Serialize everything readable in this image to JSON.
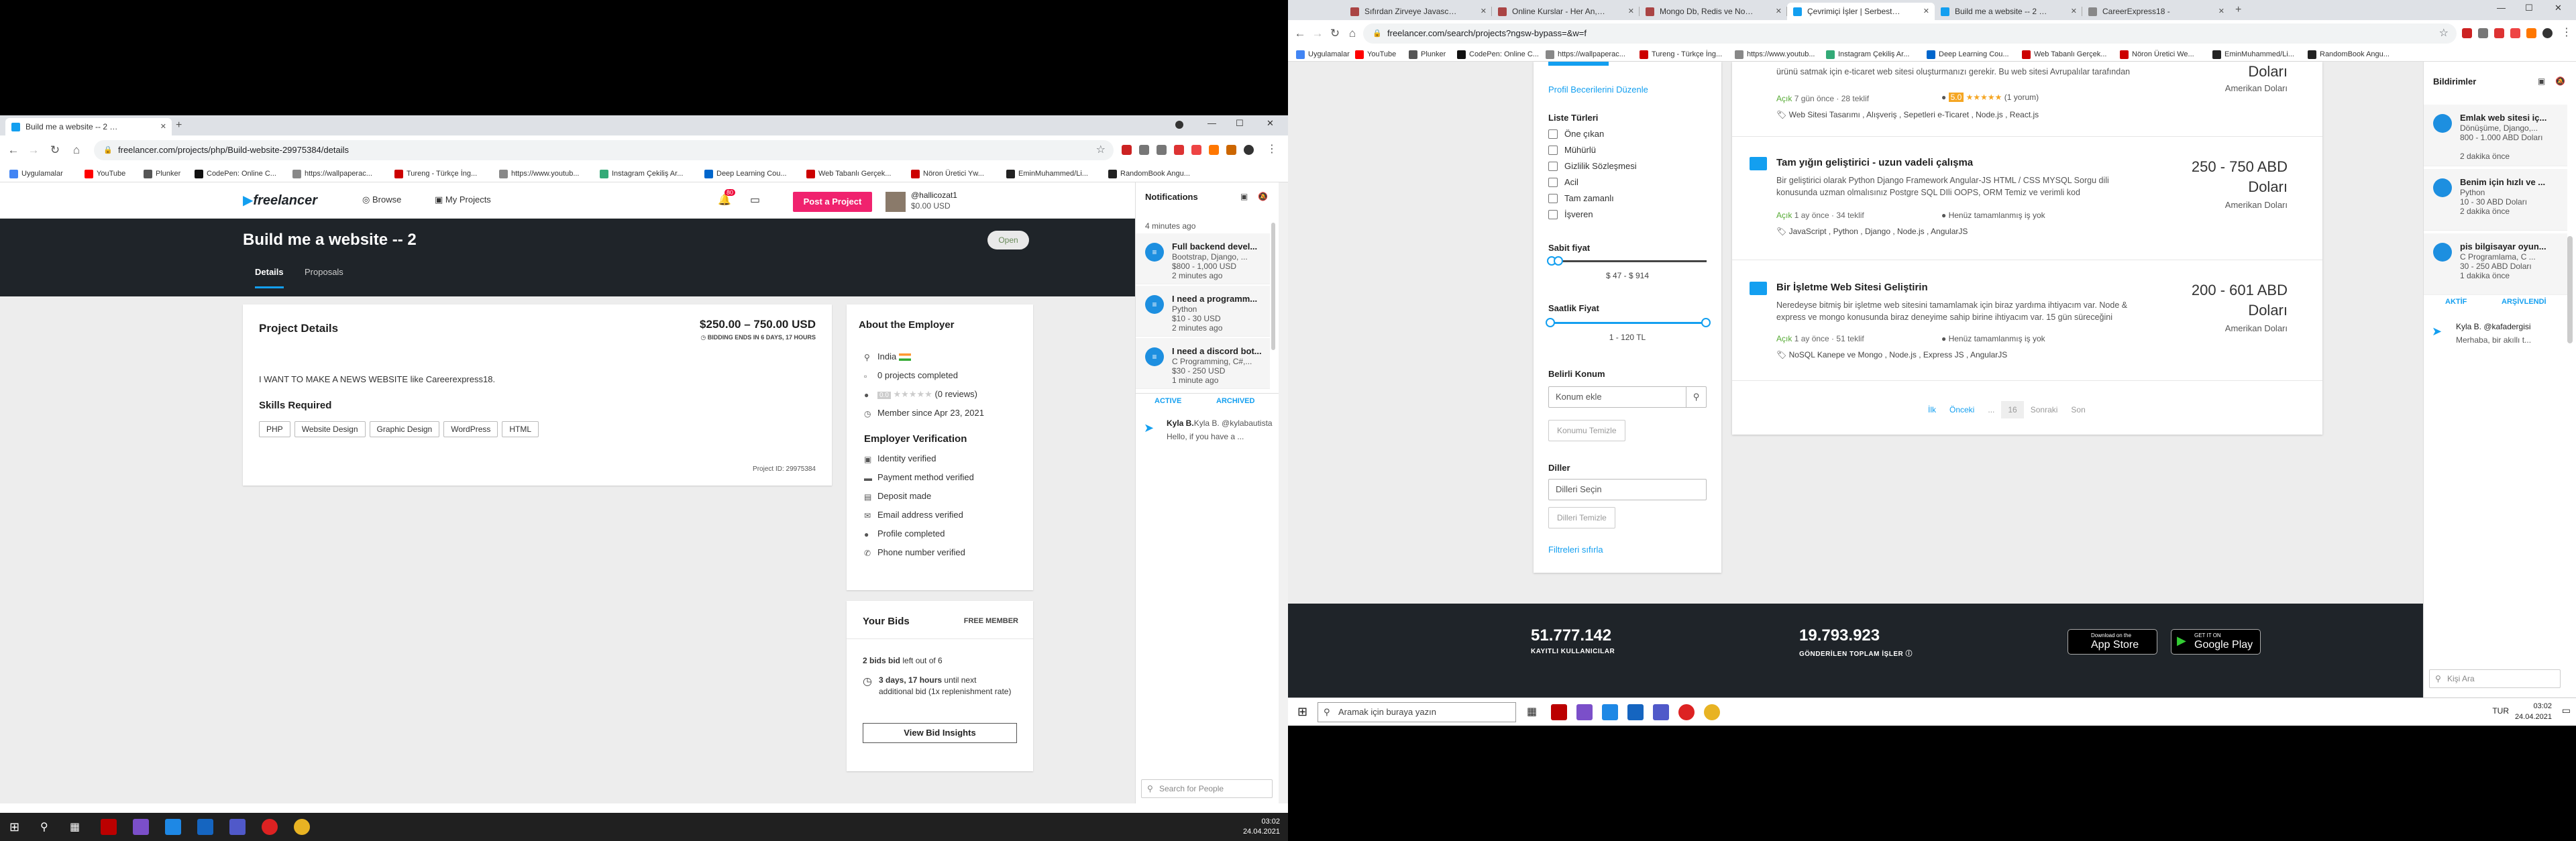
{
  "left": {
    "tabs": [
      {
        "title": "Build me a website -- 2 | Freelancer"
      }
    ],
    "url": "freelancer.com/projects/php/Build-website-29975384/details",
    "bookmarks": [
      "Uygulamalar",
      "YouTube",
      "Plunker",
      "CodePen: Online C...",
      "https://wallpaperac...",
      "Tureng - Türkçe İng...",
      "https://www.youtub...",
      "Instagram Çekiliş Ar...",
      "Deep Learning Cou...",
      "Web Tabanlı Gerçek...",
      "Nöron Üretici Yw...",
      "EminMuhammed/Li...",
      "RandomBook Angu..."
    ],
    "nav": {
      "logo": "freelancer",
      "browse": "Browse",
      "my_projects": "My Projects",
      "badge": "80",
      "post": "Post a Project",
      "user": "@hallicozat1",
      "balance": "$0.00 USD"
    },
    "hero": {
      "title": "Build me a website -- 2",
      "status": "Open",
      "tab_details": "Details",
      "tab_proposals": "Proposals"
    },
    "project": {
      "heading": "Project Details",
      "budget": "$250.00 – 750.00 USD",
      "ending": "BIDDING ENDS IN 6 DAYS, 17 HOURS",
      "description": "I WANT TO MAKE A NEWS WEBSITE like Careerexpress18.",
      "skills_heading": "Skills Required",
      "skills": [
        "PHP",
        "Website Design",
        "Graphic Design",
        "WordPress",
        "HTML"
      ],
      "project_id": "Project ID: 29975384"
    },
    "employer": {
      "heading": "About the Employer",
      "country": "India",
      "projects": "0 projects completed",
      "reviews": "(0 reviews)",
      "rating": "0.0",
      "member_since": "Member since Apr 23, 2021",
      "verification_heading": "Employer Verification",
      "verifications": [
        "Identity verified",
        "Payment method verified",
        "Deposit made",
        "Email address verified",
        "Profile completed",
        "Phone number verified"
      ]
    },
    "bids": {
      "heading": "Your Bids",
      "membership": "FREE MEMBER",
      "bids_count": "2 bids bid",
      "bids_left": "left out of 6",
      "next_bold": "3 days, 17 hours",
      "next_rest": "until next additional bid (1x replenishment rate)",
      "insights": "View Bid Insights"
    },
    "notifications": {
      "heading": "Notifications",
      "first_time": "4 minutes ago",
      "items": [
        {
          "title": "Full backend devel...",
          "line1": "Bootstrap, Django, ...",
          "line2": "$800 - 1,000 USD",
          "line3": "2 minutes ago"
        },
        {
          "title": "I need a programm...",
          "line1": "Python",
          "line2": "$10 - 30 USD",
          "line3": "2 minutes ago"
        },
        {
          "title": "I need a discord bot...",
          "line1": "C Programming, C#,...",
          "line2": "$30 - 250 USD",
          "line3": "1 minute ago"
        }
      ],
      "tab_active": "ACTIVE",
      "tab_archived": "ARCHIVED",
      "chat_name": "Kyla B. @kylabautista",
      "chat_msg": "Hello, if you have a ...",
      "search": "Search for People"
    },
    "clock": {
      "time": "03:02",
      "date": "24.04.2021"
    }
  },
  "right": {
    "tabs": [
      "Sıfırdan Zirveye Javascript ve N...",
      "Online Kurslar - Her An, Her Yer...",
      "Mongo Db, Redis ve Node.js ile...",
      "Çevrimiçi İşler | Serbest Çalışma...",
      "Build me a website -- 2 | Freela...",
      "CareerExpress18 -"
    ],
    "url": "freelancer.com/search/projects?ngsw-bypass=&w=f",
    "bookmarks": [
      "Uygulamalar",
      "YouTube",
      "Plunker",
      "CodePen: Online C...",
      "https://wallpaperac...",
      "Tureng - Türkçe İng...",
      "https://www.youtub...",
      "Instagram Çekiliş Ar...",
      "Deep Learning Cou...",
      "Web Tabanlı Gerçek...",
      "Nöron Üretici We...",
      "EminMuhammed/Li...",
      "RandomBook Angu..."
    ],
    "filters": {
      "skills_edit": "Profil Becerilerini Düzenle",
      "list_types_heading": "Liste Türleri",
      "list_types": [
        "Öne çıkan",
        "Mühürlü",
        "Gizlilik Sözleşmesi",
        "Acil",
        "Tam zamanlı",
        "İşveren"
      ],
      "fixed_heading": "Sabit fiyat",
      "fixed_range": "$ 47 - $ 914",
      "hourly_heading": "Saatlik Fiyat",
      "hourly_range": "1 - 120 TL",
      "location_heading": "Belirli Konum",
      "location_ph": "Konum ekle",
      "location_clear": "Konumu Temizle",
      "lang_heading": "Diller",
      "lang_ph": "Dilleri Seçin",
      "lang_clear": "Dilleri Temizle",
      "reset": "Filtreleri sıfırla"
    },
    "results": [
      {
        "desc": "ürünü satmak için e-ticaret web sitesi oluşturmanızı gerekir. Bu web sitesi Avrupalılar tarafından",
        "open": "Açık",
        "meta": "7 gün önce · 28 teklif",
        "rating": "5.0",
        "reviews": "(1 yorum)",
        "tags": "Web Sitesi Tasarımı , Alışveriş , Sepetleri e-Ticaret , Node.js , React.js",
        "price": "Doları",
        "currency": "Amerikan Doları"
      },
      {
        "title": "Tam yığın geliştirici - uzun vadeli çalışma",
        "desc": "Bir geliştirici olarak Python Django Framework Angular-JS HTML / CSS MYSQL Sorgu dili konusunda uzman olmalısınız Postgre SQL DIli OOPS, ORM Temiz ve verimli kod",
        "open": "Açık",
        "meta": "1 ay önce · 34 teklif",
        "status": "Henüz tamamlanmış iş yok",
        "tags": "JavaScript , Python , Django , Node.js , AngularJS",
        "price": "250 - 750 ABD Doları",
        "currency": "Amerikan Doları"
      },
      {
        "title": "Bir İşletme Web Sitesi Geliştirin",
        "desc": "Neredeyse bitmiş bir işletme web sitesini tamamlamak için biraz yardıma ihtiyacım var. Node & express ve mongo konusunda biraz deneyime sahip birine ihtiyacım var. 15 gün süreceğini",
        "open": "Açık",
        "meta": "1 ay önce · 51 teklif",
        "status": "Henüz tamamlanmış iş yok",
        "tags": "NoSQL Kanepe ve Mongo , Node.js , Express JS , AngularJS",
        "price": "200 - 601 ABD Doları",
        "currency": "Amerikan Doları"
      }
    ],
    "pager": [
      "İlk",
      "Önceki",
      "...",
      "16",
      "Sonraki",
      "Son"
    ],
    "stats": {
      "users": "51.777.142",
      "users_label": "KAYITLI KULLANICILAR",
      "jobs": "19.793.923",
      "jobs_label": "GÖNDERİLEN TOPLAM İŞLER",
      "appstore_small": "Download on the",
      "appstore": "App Store",
      "gplay_small": "GET IT ON",
      "gplay": "Google Play"
    },
    "notifications": {
      "heading": "Bildirimler",
      "items": [
        {
          "title": "Emlak web sitesi iç...",
          "line1": "Dönüşüme, Django,...",
          "line2": "800 - 1.000 ABD Doları",
          "line3": "2 dakika önce"
        },
        {
          "title": "Benim için hızlı ve ...",
          "line1": "Python",
          "line2": "10 - 30 ABD Doları",
          "line3": "2 dakika önce"
        },
        {
          "title": "pis bilgisayar oyun...",
          "line1": "C Programlama, C ...",
          "line2": "30 - 250 ABD Doları",
          "line3": "1 dakika önce"
        }
      ],
      "tab_active": "AKTİF",
      "tab_archived": "ARŞİVLENDİ",
      "chat_name": "Kyla B. @kafadergisi",
      "chat_msg": "Merhaba, bir akıllı t...",
      "search": "Kişi Ara"
    },
    "taskbar": {
      "search": "Aramak için buraya yazın",
      "lang": "TUR",
      "time": "03:02",
      "date": "24.04.2021"
    }
  }
}
